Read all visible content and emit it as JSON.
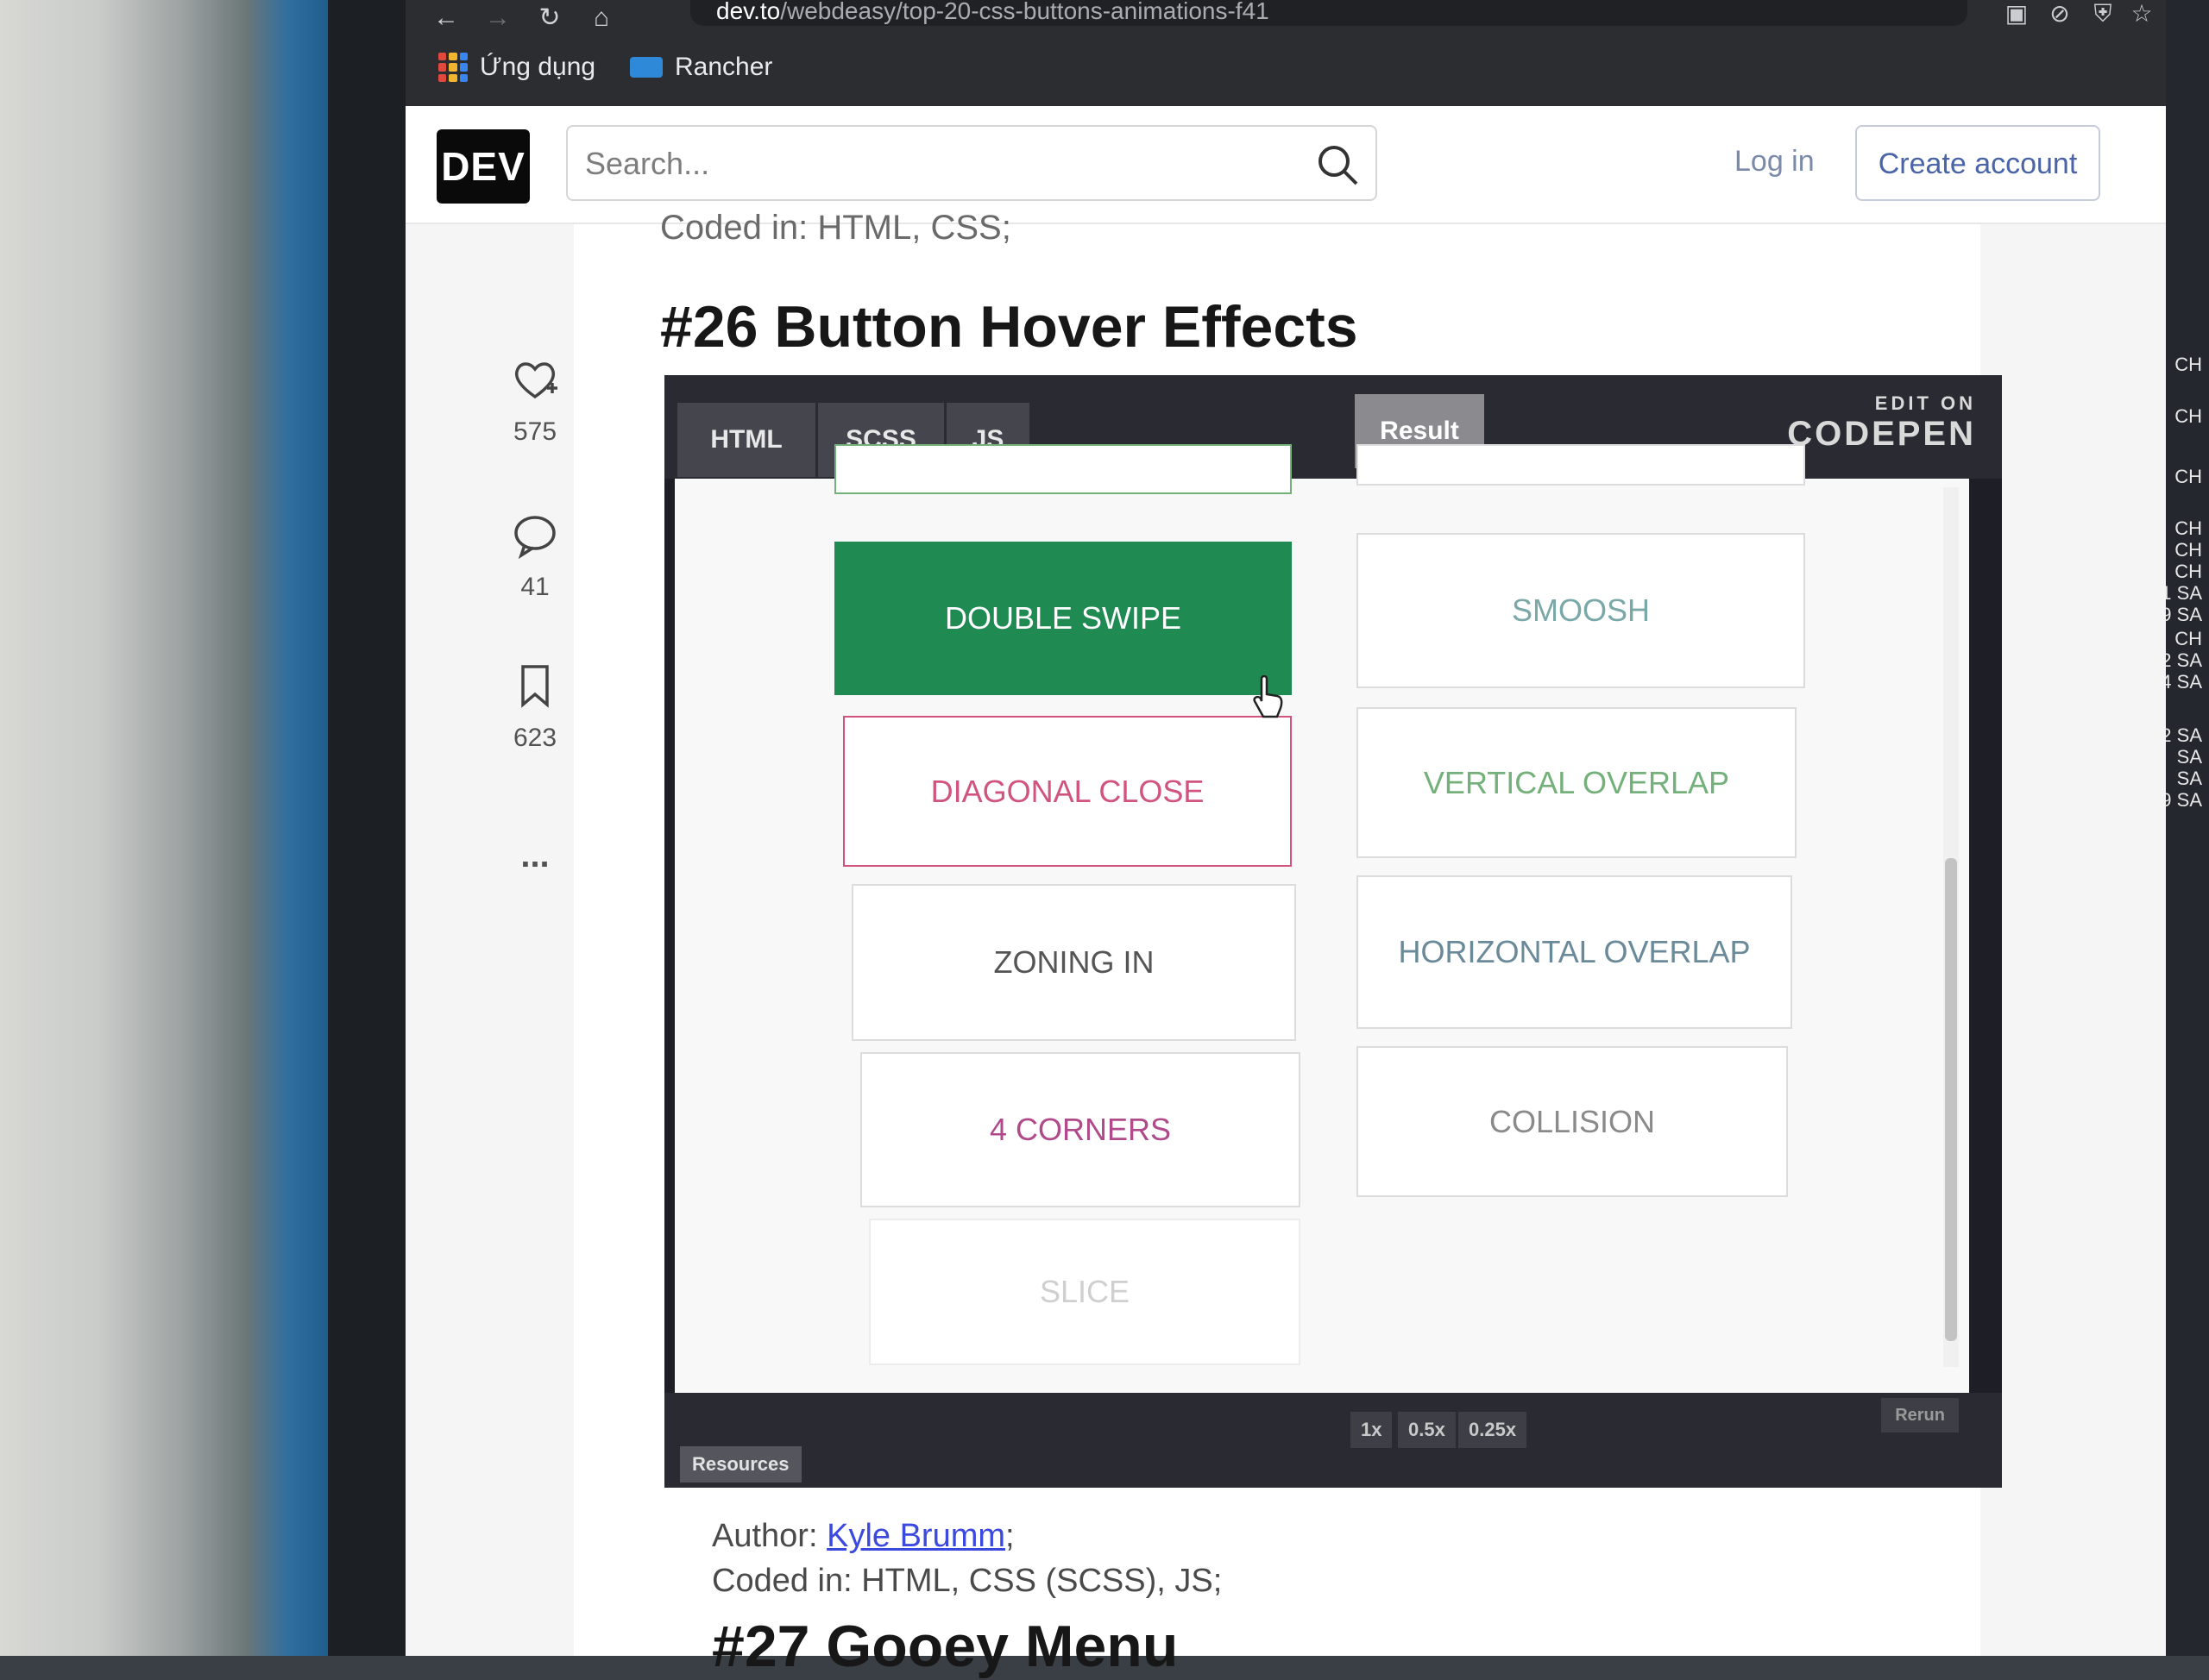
{
  "browser": {
    "url_domain": "dev.to",
    "url_path": "/webdeasy/top-20-css-buttons-animations-f41",
    "bookmarks": [
      {
        "label": "Ứng dụng",
        "icon": "apps-grid-icon"
      },
      {
        "label": "Rancher",
        "icon": "rancher-icon"
      }
    ]
  },
  "header": {
    "logo": "DEV",
    "search_placeholder": "Search...",
    "login_label": "Log in",
    "create_account_label": "Create account"
  },
  "sidebar": {
    "reactions": [
      {
        "icon": "heart-plus-icon",
        "count": "575"
      },
      {
        "icon": "comment-icon",
        "count": "41"
      },
      {
        "icon": "bookmark-icon",
        "count": "623"
      }
    ],
    "more_label": "..."
  },
  "article": {
    "coded_in_top": "Coded in: HTML, CSS;",
    "section_title": "#26 Button Hover Effects",
    "embed": {
      "tabs": [
        "HTML",
        "SCSS",
        "JS"
      ],
      "result_tab": "Result",
      "edit_on": "EDIT ON",
      "codepen": "CODEPEN",
      "buttons": [
        {
          "label": "DOUBLE SWIPE",
          "color": "#1f8a52",
          "state": "hover"
        },
        {
          "label": "SMOOSH",
          "color": "#7aa8a8"
        },
        {
          "label": "DIAGONAL CLOSE",
          "color": "#d1547e"
        },
        {
          "label": "VERTICAL OVERLAP",
          "color": "#74b07a"
        },
        {
          "label": "ZONING IN",
          "color": "#555555"
        },
        {
          "label": "HORIZONTAL OVERLAP",
          "color": "#6a8a9a"
        },
        {
          "label": "4 CORNERS",
          "color": "#b04a8a"
        },
        {
          "label": "COLLISION",
          "color": "#8a8a8a"
        },
        {
          "label": "SLICE",
          "color": "#cfcfcf"
        }
      ],
      "zoom_options": [
        "1x",
        "0.5x",
        "0.25x"
      ],
      "rerun_label": "Rerun",
      "resources_label": "Resources"
    },
    "author_label": "Author:",
    "author_name": "Kyle Brumm",
    "author_suffix": ";",
    "coded_in_bottom": "Coded in: HTML, CSS (SCSS), JS;",
    "next_section_title": "#27 Gooey Menu"
  },
  "right_strip_labels": [
    "CH",
    "CH",
    "CH",
    "CH",
    "CH",
    "CH",
    "1 SA",
    "9 SA",
    "CH",
    "2 SA",
    "4 SA",
    "2 SA",
    "SA",
    "SA",
    "9 SA"
  ]
}
